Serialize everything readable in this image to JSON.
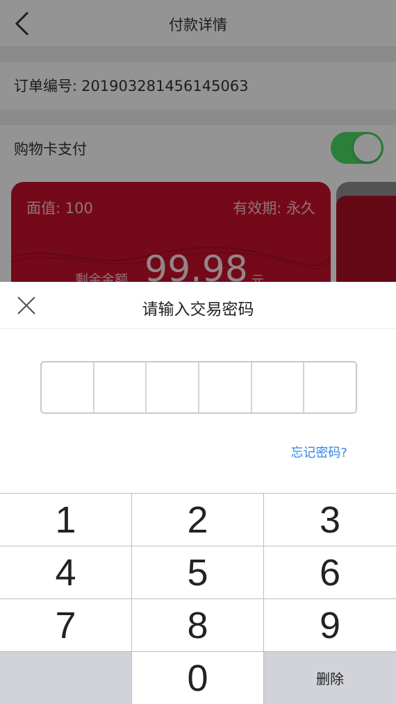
{
  "navbar": {
    "title": "付款详情"
  },
  "order": {
    "label": "订单编号:",
    "number": "201903281456145063"
  },
  "card_pay": {
    "label": "购物卡支付",
    "enabled": true
  },
  "card": {
    "face_value": "面值: 100",
    "expiry": "有效期: 永久",
    "remain_label": "剩余金额",
    "remain_amount": "99.98",
    "unit": "元"
  },
  "password_sheet": {
    "title": "请输入交易密码",
    "digit_count": 6,
    "forgot_label": "忘记密码?"
  },
  "keypad": {
    "keys": [
      "1",
      "2",
      "3",
      "4",
      "5",
      "6",
      "7",
      "8",
      "9",
      "",
      "0",
      "删除"
    ]
  },
  "colors": {
    "toggle_on": "#4cd964",
    "card_red": "#c8102e",
    "link_blue": "#2f86e8",
    "keypad_gray": "#d1d3d9"
  },
  "icons": {
    "back": "chevron-left-icon",
    "close": "close-icon"
  }
}
